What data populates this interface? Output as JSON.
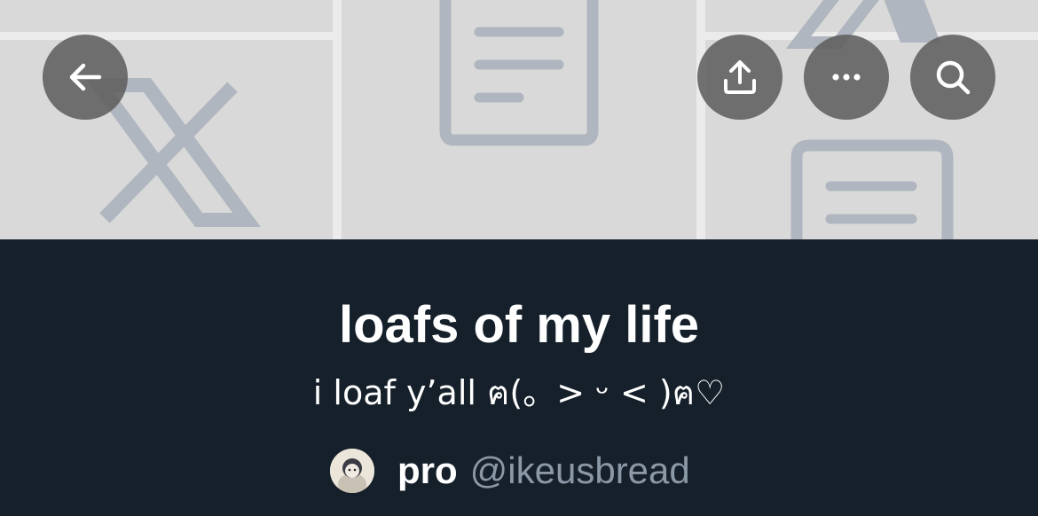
{
  "list": {
    "title": "loafs of my life",
    "description": "i loaf y’all ฅ(。> ᵕ < )ฅ♡",
    "owner_name": "pro",
    "owner_handle": "@ikeusbread"
  },
  "header": {
    "back_icon": "arrow-left-icon",
    "share_icon": "share-upload-icon",
    "more_icon": "more-horizontal-icon",
    "search_icon": "search-icon"
  },
  "colors": {
    "banner_background": "#d9d9d9",
    "banner_graphics": "#b0b6bf",
    "page_background": "#15202b",
    "button_background": "#5f5f5f",
    "handle_text": "#8b98a5"
  }
}
